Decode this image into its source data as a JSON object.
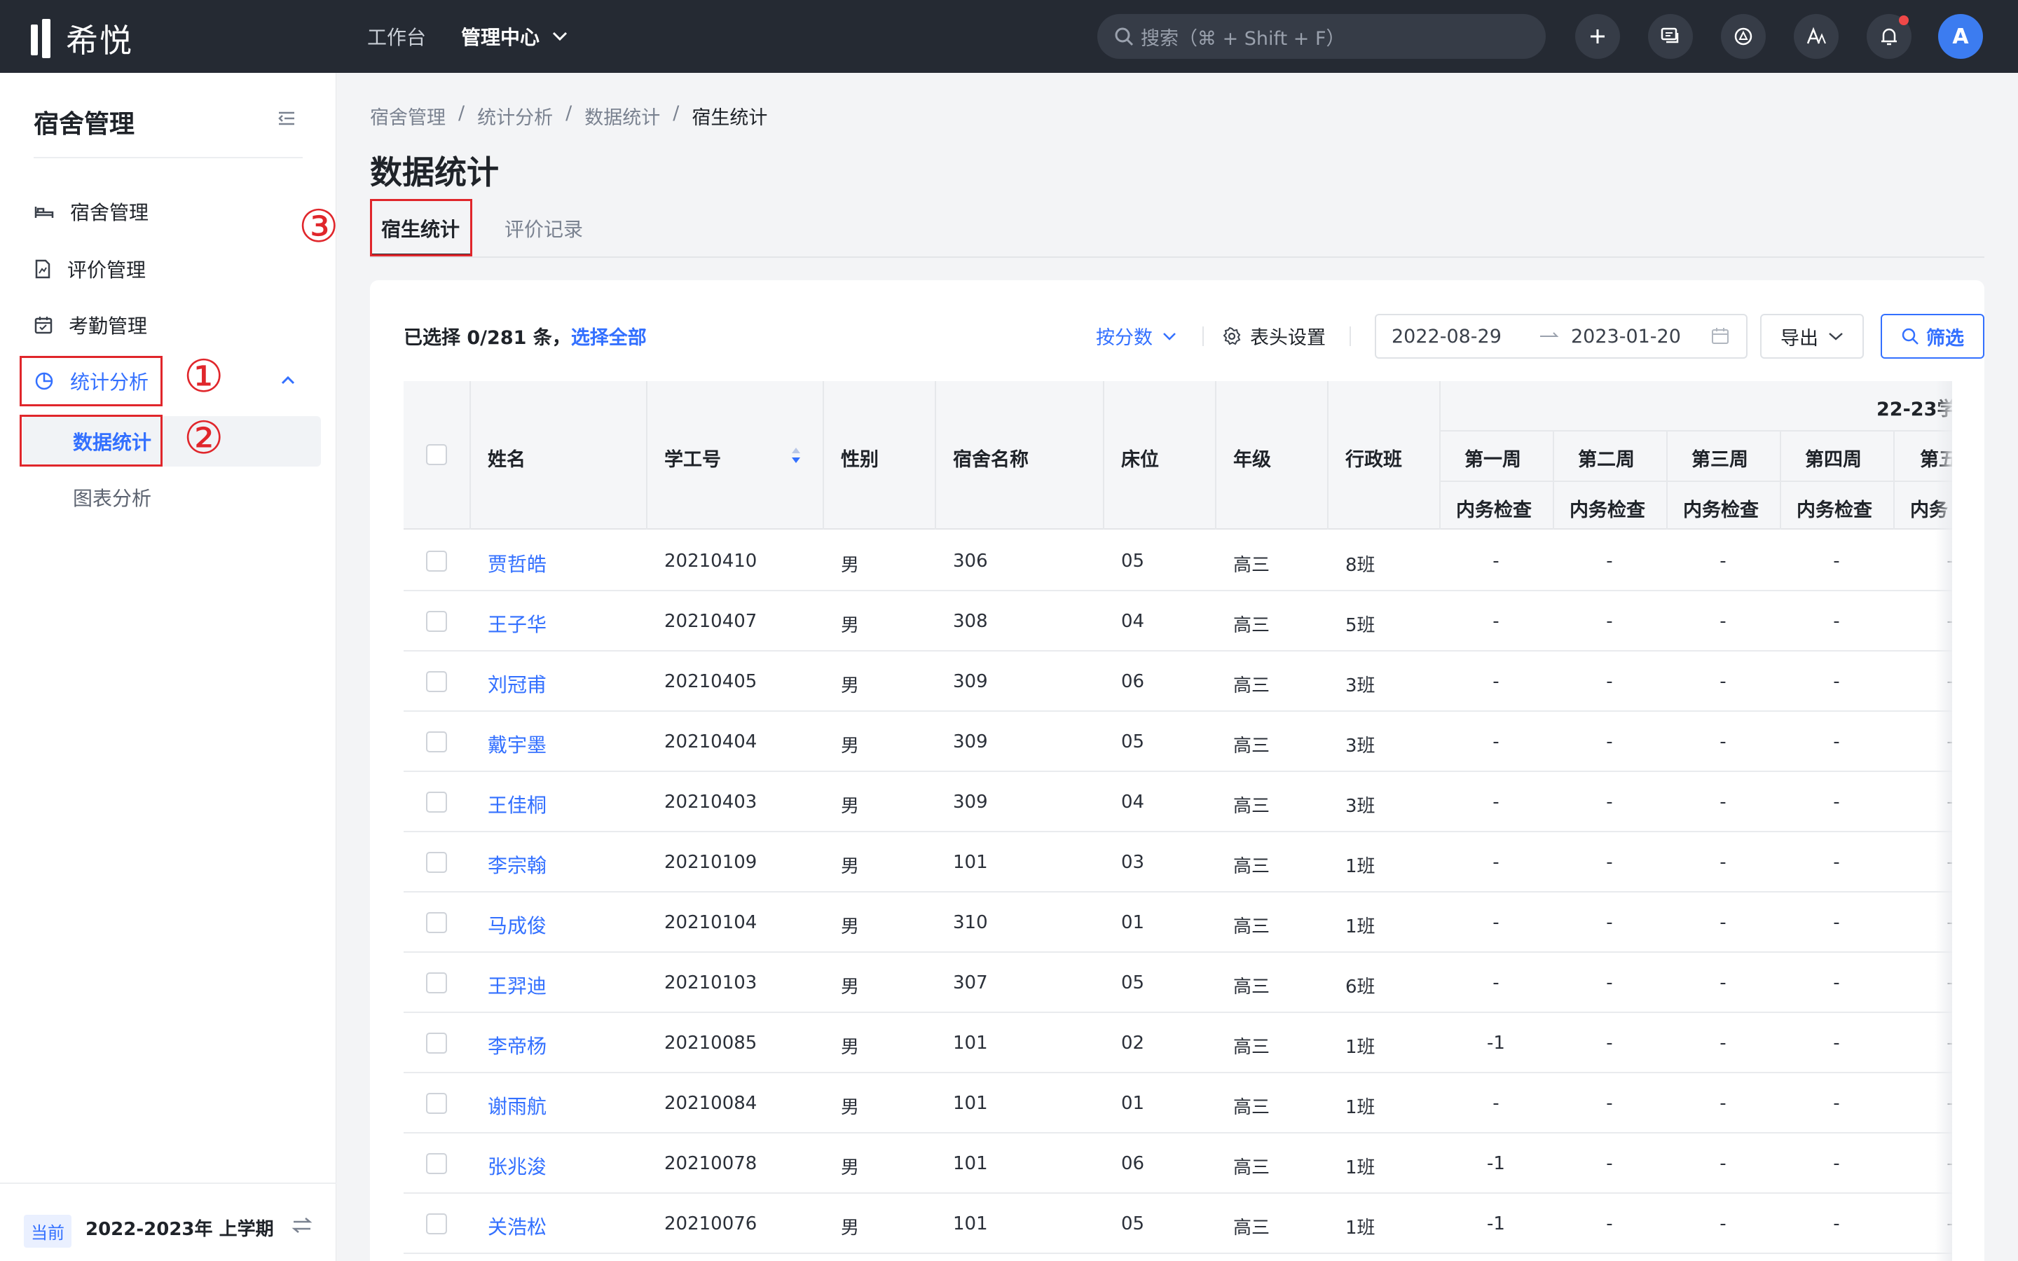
{
  "app": {
    "logo_text": "希悦"
  },
  "topnav": {
    "workbench": "工作台",
    "admin_center": "管理中心"
  },
  "search": {
    "placeholder": "搜索（⌘ + Shift + F）"
  },
  "user": {
    "avatar_letter": "A"
  },
  "sidebar": {
    "title": "宿舍管理",
    "items": [
      {
        "label": "宿舍管理",
        "icon": "bed-icon"
      },
      {
        "label": "评价管理",
        "icon": "evaluation-doc-icon"
      },
      {
        "label": "考勤管理",
        "icon": "calendar-check-icon"
      },
      {
        "label": "统计分析",
        "icon": "pie-chart-icon",
        "expanded": true
      }
    ],
    "sub_items": [
      {
        "label": "数据统计",
        "active": true
      },
      {
        "label": "图表分析"
      }
    ],
    "footer": {
      "badge": "当前",
      "term": "2022-2023年 上学期"
    }
  },
  "annotations": {
    "one": "①",
    "two": "②",
    "three": "③"
  },
  "breadcrumb": [
    "宿舍管理",
    "统计分析",
    "数据统计",
    "宿生统计"
  ],
  "page_title": "数据统计",
  "tabs": [
    "宿生统计",
    "评价记录"
  ],
  "toolbar": {
    "selected_prefix": "已选择 0/281 条，",
    "select_all": "选择全部",
    "by_score": "按分数",
    "header_settings": "表头设置",
    "date_start": "2022-08-29",
    "date_end": "2023-01-20",
    "export": "导出",
    "filter": "筛选"
  },
  "table": {
    "columns": [
      "姓名",
      "学工号",
      "性别",
      "宿舍名称",
      "床位",
      "年级",
      "行政班"
    ],
    "group_header": "22-23学",
    "weeks": [
      "第一周",
      "第二周",
      "第三周",
      "第四周",
      "第五"
    ],
    "week_sub": [
      "内务检查",
      "内务检查",
      "内务检查",
      "内务检查",
      "内务"
    ],
    "rows": [
      {
        "name": "贾哲皓",
        "id": "20210410",
        "gender": "男",
        "dorm": "306",
        "bed": "05",
        "grade": "高三",
        "class": "8班",
        "w1": "-",
        "w2": "-",
        "w3": "-",
        "w4": "-",
        "w5": "-"
      },
      {
        "name": "王子华",
        "id": "20210407",
        "gender": "男",
        "dorm": "308",
        "bed": "04",
        "grade": "高三",
        "class": "5班",
        "w1": "-",
        "w2": "-",
        "w3": "-",
        "w4": "-",
        "w5": "-"
      },
      {
        "name": "刘冠甫",
        "id": "20210405",
        "gender": "男",
        "dorm": "309",
        "bed": "06",
        "grade": "高三",
        "class": "3班",
        "w1": "-",
        "w2": "-",
        "w3": "-",
        "w4": "-",
        "w5": "-"
      },
      {
        "name": "戴宇墨",
        "id": "20210404",
        "gender": "男",
        "dorm": "309",
        "bed": "05",
        "grade": "高三",
        "class": "3班",
        "w1": "-",
        "w2": "-",
        "w3": "-",
        "w4": "-",
        "w5": "-"
      },
      {
        "name": "王佳桐",
        "id": "20210403",
        "gender": "男",
        "dorm": "309",
        "bed": "04",
        "grade": "高三",
        "class": "3班",
        "w1": "-",
        "w2": "-",
        "w3": "-",
        "w4": "-",
        "w5": "-"
      },
      {
        "name": "李宗翰",
        "id": "20210109",
        "gender": "男",
        "dorm": "101",
        "bed": "03",
        "grade": "高三",
        "class": "1班",
        "w1": "-",
        "w2": "-",
        "w3": "-",
        "w4": "-",
        "w5": "-"
      },
      {
        "name": "马成俊",
        "id": "20210104",
        "gender": "男",
        "dorm": "310",
        "bed": "01",
        "grade": "高三",
        "class": "1班",
        "w1": "-",
        "w2": "-",
        "w3": "-",
        "w4": "-",
        "w5": "-"
      },
      {
        "name": "王羿迪",
        "id": "20210103",
        "gender": "男",
        "dorm": "307",
        "bed": "05",
        "grade": "高三",
        "class": "6班",
        "w1": "-",
        "w2": "-",
        "w3": "-",
        "w4": "-",
        "w5": "-"
      },
      {
        "name": "李帝杨",
        "id": "20210085",
        "gender": "男",
        "dorm": "101",
        "bed": "02",
        "grade": "高三",
        "class": "1班",
        "w1": "-1",
        "w2": "-",
        "w3": "-",
        "w4": "-",
        "w5": "-"
      },
      {
        "name": "谢雨航",
        "id": "20210084",
        "gender": "男",
        "dorm": "101",
        "bed": "01",
        "grade": "高三",
        "class": "1班",
        "w1": "-",
        "w2": "-",
        "w3": "-",
        "w4": "-",
        "w5": "-"
      },
      {
        "name": "张兆浚",
        "id": "20210078",
        "gender": "男",
        "dorm": "101",
        "bed": "06",
        "grade": "高三",
        "class": "1班",
        "w1": "-1",
        "w2": "-",
        "w3": "-",
        "w4": "-",
        "w5": "-"
      },
      {
        "name": "关浩松",
        "id": "20210076",
        "gender": "男",
        "dorm": "101",
        "bed": "05",
        "grade": "高三",
        "class": "1班",
        "w1": "-1",
        "w2": "-",
        "w3": "-",
        "w4": "-",
        "w5": "-"
      }
    ]
  },
  "colors": {
    "accent": "#3370ff",
    "topbar": "#252a33",
    "annotation": "#e0262b"
  }
}
